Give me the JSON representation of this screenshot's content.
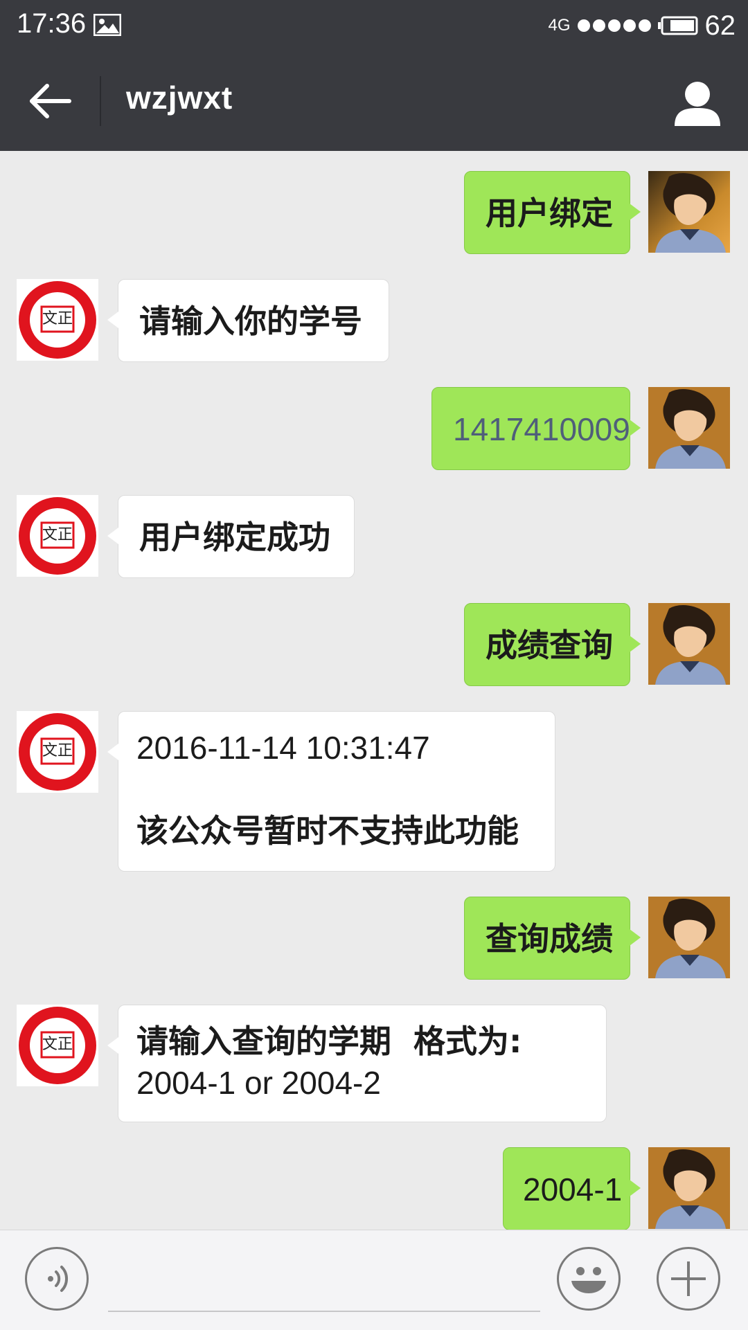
{
  "status_bar": {
    "time": "17:36",
    "network": "4G",
    "signal_dots": 5,
    "battery_level": "62",
    "icons": [
      "image-icon",
      "battery-icon"
    ]
  },
  "header": {
    "title": "wzjwxt",
    "icons": [
      "back-arrow-icon",
      "profile-icon"
    ]
  },
  "messages": [
    {
      "side": "out",
      "text": "用户绑定"
    },
    {
      "side": "in",
      "text": "请输入你的学号"
    },
    {
      "side": "out",
      "text": "1417410009"
    },
    {
      "side": "in",
      "text": "用户绑定成功"
    },
    {
      "side": "out",
      "text": "成绩查询"
    },
    {
      "side": "in",
      "timestamp": "2016-11-14 10:31:47",
      "text": "该公众号暂时不支持此功能"
    },
    {
      "side": "out",
      "text": "查询成绩"
    },
    {
      "side": "in",
      "text_line1": "请输入查询的学期  格式为:",
      "text_line2": "2004-1 or 2004-2"
    },
    {
      "side": "out",
      "text": "2004-1"
    }
  ],
  "input_bar": {
    "icons": [
      "voice-icon",
      "emoji-icon",
      "plus-icon"
    ]
  },
  "colors": {
    "bar": "#393a3f",
    "chat_bg": "#ebebeb",
    "outgoing_bubble": "#9fe658",
    "incoming_bubble": "#ffffff",
    "logo_red": "#e0141e"
  }
}
